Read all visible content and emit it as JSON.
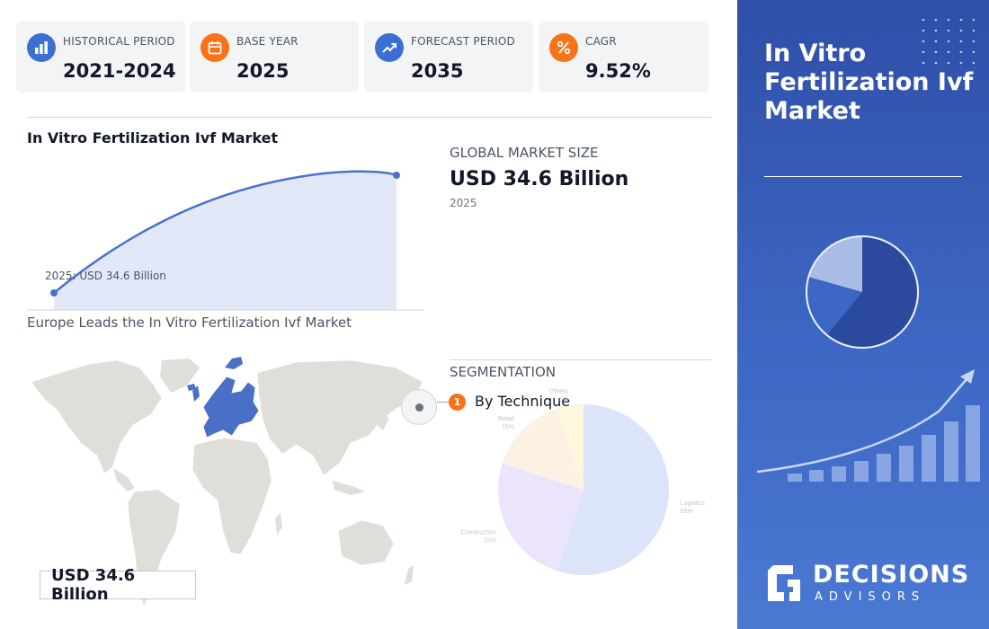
{
  "stats": [
    {
      "label": "HISTORICAL PERIOD",
      "value": "2021-2024",
      "icon": "bar-chart-icon",
      "color": "#3b6fd4"
    },
    {
      "label": "BASE YEAR",
      "value": "2025",
      "icon": "calendar-icon",
      "color": "#f97316"
    },
    {
      "label": "FORECAST PERIOD",
      "value": "2035",
      "icon": "trend-up-icon",
      "color": "#3b6fd4"
    },
    {
      "label": "CAGR",
      "value": "9.52%",
      "icon": "percent-icon",
      "color": "#f97316"
    }
  ],
  "growth_chart": {
    "title": "In Vitro Fertilization Ivf Market",
    "annotation": "2025: USD 34.6 Billion"
  },
  "market_size": {
    "label": "GLOBAL MARKET SIZE",
    "value": "USD 34.6 Billion",
    "year": "2025"
  },
  "map": {
    "title": "Europe Leads the In Vitro Fertilization Ivf Market",
    "value_box": "USD 34.6 Billion",
    "highlight_color": "#4a6fc7"
  },
  "segmentation": {
    "title": "SEGMENTATION",
    "item_number": "1",
    "item_label": "By Technique"
  },
  "chart_data": {
    "type": "pie",
    "categories": [
      "Logistics",
      "Construction",
      "Retail",
      "Others"
    ],
    "values": [
      55,
      25,
      15,
      5
    ],
    "value_labels": [
      "55%",
      "25%",
      "15%",
      "5%"
    ],
    "colors": [
      "#dbe4f8",
      "#ece4fa",
      "#fdf1e4",
      "#fdf7dc"
    ]
  },
  "panel": {
    "title": "In Vitro Fertilization Ivf Market",
    "brand_top": "DECISIONS",
    "brand_bottom": "ADVISORS"
  }
}
